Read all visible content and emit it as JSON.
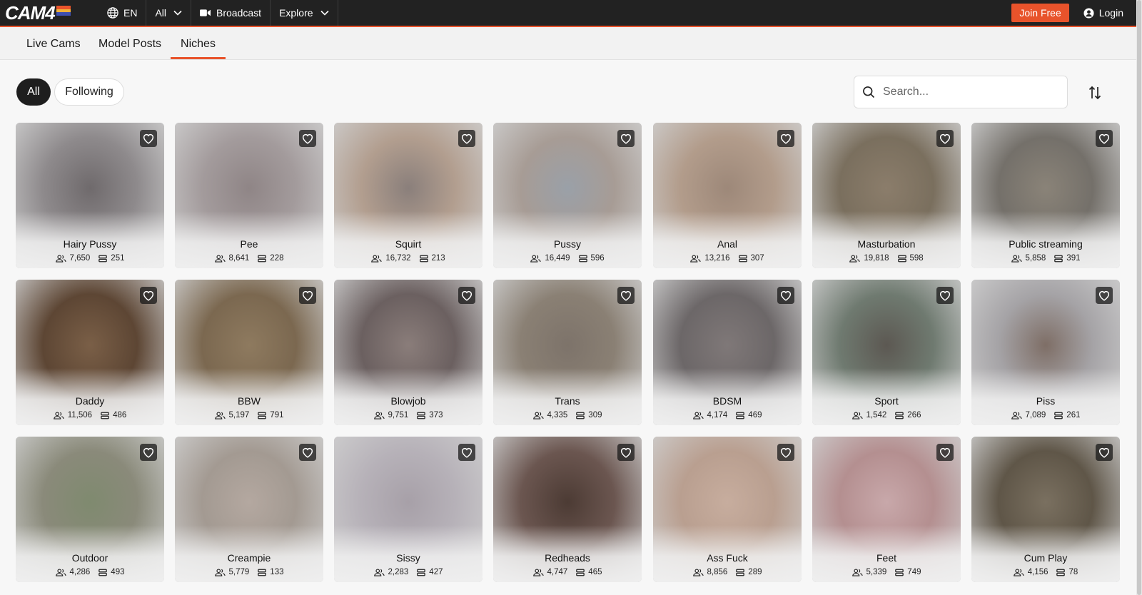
{
  "brand": {
    "logo_text": "CAM4",
    "accent": "#e8532b"
  },
  "topnav": {
    "language": "EN",
    "filter": "All",
    "broadcast": "Broadcast",
    "explore": "Explore",
    "join": "Join Free",
    "login": "Login"
  },
  "subnav": {
    "tabs": [
      {
        "label": "Live Cams"
      },
      {
        "label": "Model Posts"
      },
      {
        "label": "Niches"
      }
    ],
    "active": "Niches"
  },
  "filters": {
    "all": "All",
    "following": "Following"
  },
  "search": {
    "placeholder": "Search..."
  },
  "niches": [
    {
      "name": "Hairy Pussy",
      "viewers": "7,650",
      "rooms": "251",
      "tone": [
        "#8e8a8c",
        "#6f6a6c"
      ]
    },
    {
      "name": "Pee",
      "viewers": "8,641",
      "rooms": "228",
      "tone": [
        "#a39b9c",
        "#8f8586"
      ]
    },
    {
      "name": "Squirt",
      "viewers": "16,732",
      "rooms": "213",
      "tone": [
        "#b29e8f",
        "#8a7f7b"
      ]
    },
    {
      "name": "Pussy",
      "viewers": "16,449",
      "rooms": "596",
      "tone": [
        "#a79c95",
        "#9aa0a8"
      ]
    },
    {
      "name": "Anal",
      "viewers": "13,216",
      "rooms": "307",
      "tone": [
        "#b29c8b",
        "#9d8879"
      ]
    },
    {
      "name": "Masturbation",
      "viewers": "19,818",
      "rooms": "598",
      "tone": [
        "#7a6f5e",
        "#8b7d6b"
      ]
    },
    {
      "name": "Public streaming",
      "viewers": "5,858",
      "rooms": "391",
      "tone": [
        "#74706a",
        "#8a8378"
      ]
    },
    {
      "name": "Daddy",
      "viewers": "11,506",
      "rooms": "486",
      "tone": [
        "#5d4634",
        "#7a5f47"
      ]
    },
    {
      "name": "BBW",
      "viewers": "5,197",
      "rooms": "791",
      "tone": [
        "#7b6850",
        "#8e7a5f"
      ]
    },
    {
      "name": "Blowjob",
      "viewers": "9,751",
      "rooms": "373",
      "tone": [
        "#6b6060",
        "#8a7d7a"
      ]
    },
    {
      "name": "Trans",
      "viewers": "4,335",
      "rooms": "309",
      "tone": [
        "#8a8074",
        "#7d736a"
      ]
    },
    {
      "name": "BDSM",
      "viewers": "4,174",
      "rooms": "469",
      "tone": [
        "#6c6768",
        "#7f7878"
      ]
    },
    {
      "name": "Sport",
      "viewers": "1,542",
      "rooms": "266",
      "tone": [
        "#6f7a70",
        "#5c5852"
      ]
    },
    {
      "name": "Piss",
      "viewers": "7,089",
      "rooms": "261",
      "tone": [
        "#a5a3a6",
        "#7e6e66"
      ]
    },
    {
      "name": "Outdoor",
      "viewers": "4,286",
      "rooms": "493",
      "tone": [
        "#8a8a7a",
        "#7f8a6f"
      ]
    },
    {
      "name": "Creampie",
      "viewers": "5,779",
      "rooms": "133",
      "tone": [
        "#a39a92",
        "#b4a8a0"
      ]
    },
    {
      "name": "Sissy",
      "viewers": "2,283",
      "rooms": "427",
      "tone": [
        "#b6b1b8",
        "#a7a0a8"
      ]
    },
    {
      "name": "Redheads",
      "viewers": "4,747",
      "rooms": "465",
      "tone": [
        "#6b5650",
        "#4c3b34"
      ]
    },
    {
      "name": "Ass Fuck",
      "viewers": "8,856",
      "rooms": "289",
      "tone": [
        "#b99f90",
        "#c7ad9e"
      ]
    },
    {
      "name": "Feet",
      "viewers": "5,339",
      "rooms": "749",
      "tone": [
        "#b48f90",
        "#c8a8aa"
      ]
    },
    {
      "name": "Cum Play",
      "viewers": "4,156",
      "rooms": "78",
      "tone": [
        "#5f5648",
        "#7a7060"
      ]
    }
  ]
}
